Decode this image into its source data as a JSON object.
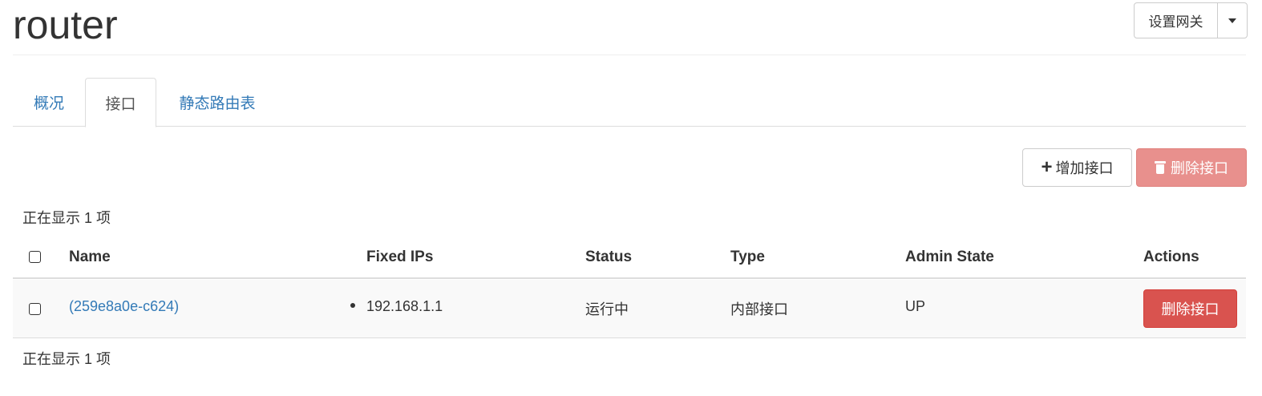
{
  "header": {
    "title": "router",
    "gateway_button_label": "设置网关",
    "gateway_dropdown_icon": "caret-down-icon"
  },
  "tabs": [
    {
      "label": "概况",
      "active": false
    },
    {
      "label": "接口",
      "active": true
    },
    {
      "label": "静态路由表",
      "active": false
    }
  ],
  "toolbar": {
    "add_label": "增加接口",
    "add_icon": "plus-icon",
    "delete_label": "删除接口",
    "delete_icon": "trash-icon"
  },
  "table": {
    "count_text_top": "正在显示 1 项",
    "count_text_bottom": "正在显示 1 项",
    "columns": [
      "Name",
      "Fixed IPs",
      "Status",
      "Type",
      "Admin State",
      "Actions"
    ],
    "rows": [
      {
        "name": "(259e8a0e-c624)",
        "fixed_ips": [
          "192.168.1.1"
        ],
        "status": "运行中",
        "type": "内部接口",
        "admin_state": "UP",
        "action_label": "删除接口"
      }
    ]
  },
  "colors": {
    "link": "#337ab7",
    "danger": "#d9534f",
    "danger_disabled": "#e8908d",
    "row_bg": "#f9f9f9"
  }
}
